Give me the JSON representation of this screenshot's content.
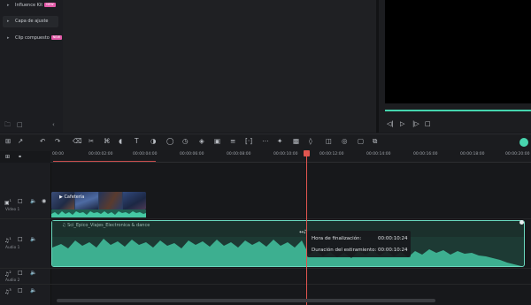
{
  "left_panel": {
    "items": [
      {
        "label": "Influence Kit",
        "badge": "NEW"
      },
      {
        "label": "Capa de ajuste",
        "badge": ""
      },
      {
        "label": "Clip compuesto",
        "badge": "NEW"
      }
    ]
  },
  "icons": {
    "new_folder": "folder-add-icon",
    "import_folder": "folder-open-icon",
    "collapse": "chevron-left-icon",
    "preview_controls": [
      "previous-frame-icon",
      "play-icon",
      "next-frame-icon",
      "stop-icon"
    ],
    "toolbar": [
      "layout-grid-icon",
      "select-pointer-icon",
      "undo-icon",
      "redo-icon",
      "delete-icon",
      "cut-icon",
      "crop-icon",
      "speed-icon",
      "text-icon",
      "color-icon",
      "timer-icon",
      "mask-icon",
      "keyframe-icon",
      "adjust-icon",
      "split-icon",
      "marker-icon",
      "audio-icon",
      "ai-icon",
      "transition-icon",
      "speed-ramp-icon",
      "snapshot-icon",
      "motion-icon",
      "crop-zoom-icon",
      "group-icon"
    ]
  },
  "timeline": {
    "ruler_labels": [
      "00:00",
      "00:00:02:00",
      "00:00:04:00",
      "00:00:06:00",
      "00:00:08:00",
      "00:00:10:00",
      "00:00:12:00",
      "00:00:14:00",
      "00:00:16:00",
      "00:00:18:00",
      "00:00:20:00"
    ],
    "tracks": {
      "video1": {
        "number": "1",
        "label": "Vídeo 1"
      },
      "audio1": {
        "number": "1",
        "label": "Audio 1"
      },
      "audio2": {
        "number": "2",
        "label": "Audio 2"
      },
      "audio3": {
        "number": "3",
        "label": ""
      }
    },
    "video_clip_label": "Cafetería",
    "audio_clip_name": "Sci_Epico_Viajes_Electronica & dance",
    "tooltip": {
      "end_time_label": "Hora de finalización:",
      "end_time_value": "00:00:10:24",
      "stretch_label": "Duración del estiramiento:",
      "stretch_value": "00:00:10:24"
    }
  },
  "colors": {
    "accent": "#45d4ad",
    "playhead": "#e0554f",
    "audio_clip": "#2f8f78",
    "badge": "#e35aa8"
  }
}
